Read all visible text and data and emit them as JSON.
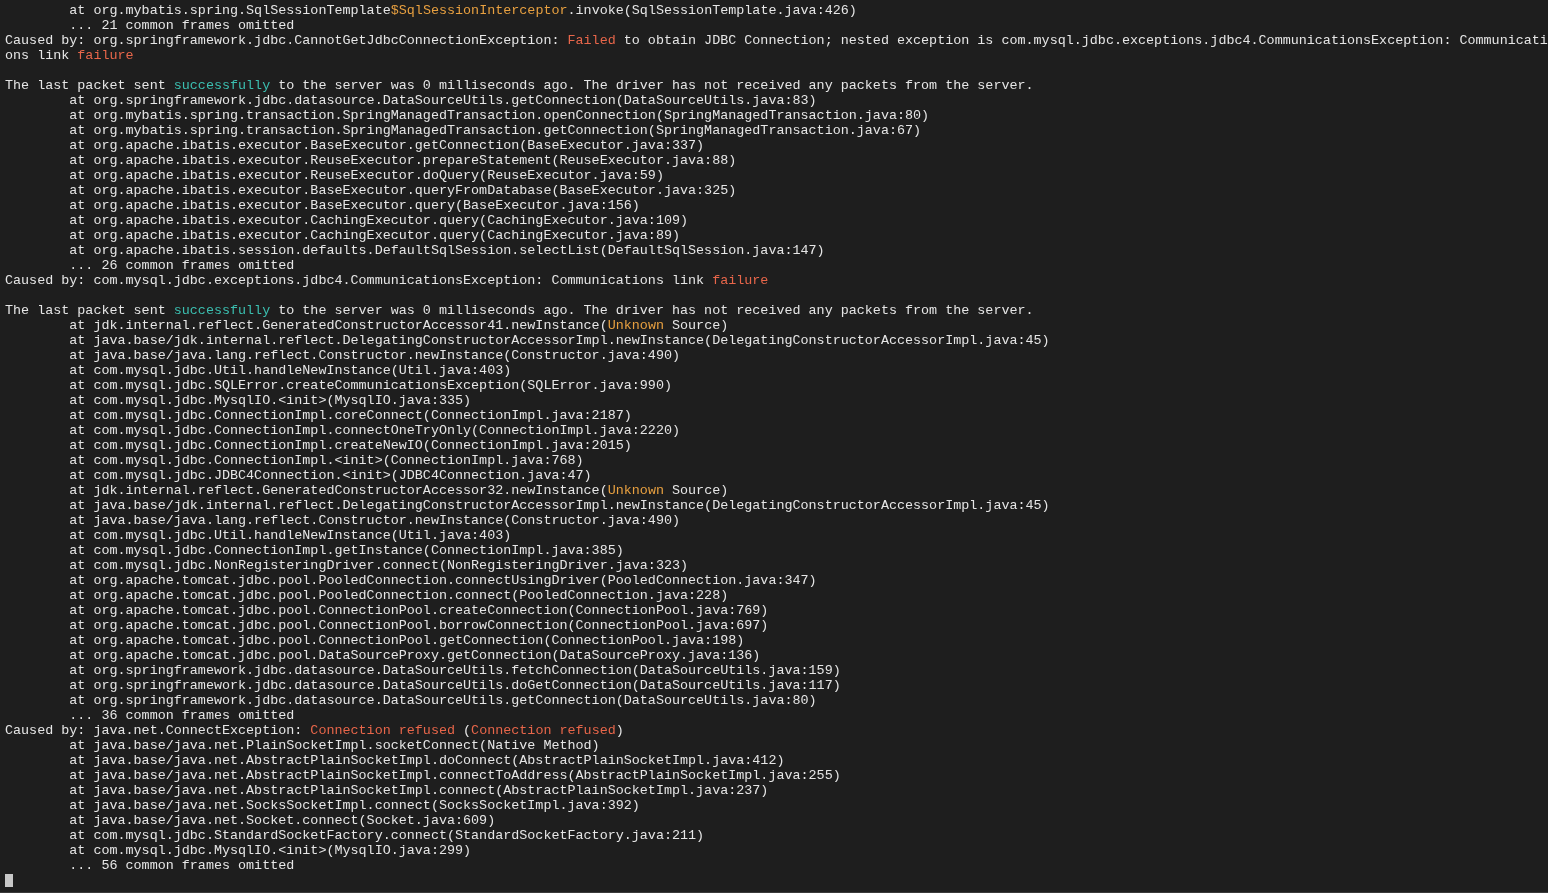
{
  "terminal": {
    "lines": [
      {
        "kind": "text",
        "parts": [
          {
            "text": "\tat org.mybatis.spring.SqlSessionTemplate"
          },
          {
            "text": "$SqlSessionInterceptor",
            "color": "#e8a040"
          },
          {
            "text": ".invoke(SqlSessionTemplate.java:426)"
          }
        ]
      },
      {
        "kind": "text",
        "parts": [
          {
            "text": "\t... 21 common frames omitted"
          }
        ]
      },
      {
        "kind": "text",
        "parts": [
          {
            "text": "Caused by: org.springframework.jdbc.CannotGetJdbcConnectionException: "
          },
          {
            "text": "Failed",
            "color": "#e8664a"
          },
          {
            "text": " to obtain JDBC Connection; nested exception is com.mysql.jdbc.exceptions.jdbc4.CommunicationsException: Communicati"
          }
        ]
      },
      {
        "kind": "text",
        "parts": [
          {
            "text": "ons link "
          },
          {
            "text": "failure",
            "color": "#e8664a"
          }
        ]
      },
      {
        "kind": "blank"
      },
      {
        "kind": "text",
        "parts": [
          {
            "text": "The last packet sent "
          },
          {
            "text": "successfully",
            "color": "#3bbfb0"
          },
          {
            "text": " to the server was 0 milliseconds ago. The driver has not received any packets from the server."
          }
        ]
      },
      {
        "kind": "text",
        "parts": [
          {
            "text": "\tat org.springframework.jdbc.datasource.DataSourceUtils.getConnection(DataSourceUtils.java:83)"
          }
        ]
      },
      {
        "kind": "text",
        "parts": [
          {
            "text": "\tat org.mybatis.spring.transaction.SpringManagedTransaction.openConnection(SpringManagedTransaction.java:80)"
          }
        ]
      },
      {
        "kind": "text",
        "parts": [
          {
            "text": "\tat org.mybatis.spring.transaction.SpringManagedTransaction.getConnection(SpringManagedTransaction.java:67)"
          }
        ]
      },
      {
        "kind": "text",
        "parts": [
          {
            "text": "\tat org.apache.ibatis.executor.BaseExecutor.getConnection(BaseExecutor.java:337)"
          }
        ]
      },
      {
        "kind": "text",
        "parts": [
          {
            "text": "\tat org.apache.ibatis.executor.ReuseExecutor.prepareStatement(ReuseExecutor.java:88)"
          }
        ]
      },
      {
        "kind": "text",
        "parts": [
          {
            "text": "\tat org.apache.ibatis.executor.ReuseExecutor.doQuery(ReuseExecutor.java:59)"
          }
        ]
      },
      {
        "kind": "text",
        "parts": [
          {
            "text": "\tat org.apache.ibatis.executor.BaseExecutor.queryFromDatabase(BaseExecutor.java:325)"
          }
        ]
      },
      {
        "kind": "text",
        "parts": [
          {
            "text": "\tat org.apache.ibatis.executor.BaseExecutor.query(BaseExecutor.java:156)"
          }
        ]
      },
      {
        "kind": "text",
        "parts": [
          {
            "text": "\tat org.apache.ibatis.executor.CachingExecutor.query(CachingExecutor.java:109)"
          }
        ]
      },
      {
        "kind": "text",
        "parts": [
          {
            "text": "\tat org.apache.ibatis.executor.CachingExecutor.query(CachingExecutor.java:89)"
          }
        ]
      },
      {
        "kind": "text",
        "parts": [
          {
            "text": "\tat org.apache.ibatis.session.defaults.DefaultSqlSession.selectList(DefaultSqlSession.java:147)"
          }
        ]
      },
      {
        "kind": "text",
        "parts": [
          {
            "text": "\t... 26 common frames omitted"
          }
        ]
      },
      {
        "kind": "text",
        "parts": [
          {
            "text": "Caused by: com.mysql.jdbc.exceptions.jdbc4.CommunicationsException: Communications link "
          },
          {
            "text": "failure",
            "color": "#e8664a"
          }
        ]
      },
      {
        "kind": "blank"
      },
      {
        "kind": "text",
        "parts": [
          {
            "text": "The last packet sent "
          },
          {
            "text": "successfully",
            "color": "#3bbfb0"
          },
          {
            "text": " to the server was 0 milliseconds ago. The driver has not received any packets from the server."
          }
        ]
      },
      {
        "kind": "text",
        "parts": [
          {
            "text": "\tat jdk.internal.reflect.GeneratedConstructorAccessor41.newInstance("
          },
          {
            "text": "Unknown",
            "color": "#e8a040"
          },
          {
            "text": " Source)"
          }
        ]
      },
      {
        "kind": "text",
        "parts": [
          {
            "text": "\tat java.base/jdk.internal.reflect.DelegatingConstructorAccessorImpl.newInstance(DelegatingConstructorAccessorImpl.java:45)"
          }
        ]
      },
      {
        "kind": "text",
        "parts": [
          {
            "text": "\tat java.base/java.lang.reflect.Constructor.newInstance(Constructor.java:490)"
          }
        ]
      },
      {
        "kind": "text",
        "parts": [
          {
            "text": "\tat com.mysql.jdbc.Util.handleNewInstance(Util.java:403)"
          }
        ]
      },
      {
        "kind": "text",
        "parts": [
          {
            "text": "\tat com.mysql.jdbc.SQLError.createCommunicationsException(SQLError.java:990)"
          }
        ]
      },
      {
        "kind": "text",
        "parts": [
          {
            "text": "\tat com.mysql.jdbc.MysqlIO.<init>(MysqlIO.java:335)"
          }
        ]
      },
      {
        "kind": "text",
        "parts": [
          {
            "text": "\tat com.mysql.jdbc.ConnectionImpl.coreConnect(ConnectionImpl.java:2187)"
          }
        ]
      },
      {
        "kind": "text",
        "parts": [
          {
            "text": "\tat com.mysql.jdbc.ConnectionImpl.connectOneTryOnly(ConnectionImpl.java:2220)"
          }
        ]
      },
      {
        "kind": "text",
        "parts": [
          {
            "text": "\tat com.mysql.jdbc.ConnectionImpl.createNewIO(ConnectionImpl.java:2015)"
          }
        ]
      },
      {
        "kind": "text",
        "parts": [
          {
            "text": "\tat com.mysql.jdbc.ConnectionImpl.<init>(ConnectionImpl.java:768)"
          }
        ]
      },
      {
        "kind": "text",
        "parts": [
          {
            "text": "\tat com.mysql.jdbc.JDBC4Connection.<init>(JDBC4Connection.java:47)"
          }
        ]
      },
      {
        "kind": "text",
        "parts": [
          {
            "text": "\tat jdk.internal.reflect.GeneratedConstructorAccessor32.newInstance("
          },
          {
            "text": "Unknown",
            "color": "#e8a040"
          },
          {
            "text": " Source)"
          }
        ]
      },
      {
        "kind": "text",
        "parts": [
          {
            "text": "\tat java.base/jdk.internal.reflect.DelegatingConstructorAccessorImpl.newInstance(DelegatingConstructorAccessorImpl.java:45)"
          }
        ]
      },
      {
        "kind": "text",
        "parts": [
          {
            "text": "\tat java.base/java.lang.reflect.Constructor.newInstance(Constructor.java:490)"
          }
        ]
      },
      {
        "kind": "text",
        "parts": [
          {
            "text": "\tat com.mysql.jdbc.Util.handleNewInstance(Util.java:403)"
          }
        ]
      },
      {
        "kind": "text",
        "parts": [
          {
            "text": "\tat com.mysql.jdbc.ConnectionImpl.getInstance(ConnectionImpl.java:385)"
          }
        ]
      },
      {
        "kind": "text",
        "parts": [
          {
            "text": "\tat com.mysql.jdbc.NonRegisteringDriver.connect(NonRegisteringDriver.java:323)"
          }
        ]
      },
      {
        "kind": "text",
        "parts": [
          {
            "text": "\tat org.apache.tomcat.jdbc.pool.PooledConnection.connectUsingDriver(PooledConnection.java:347)"
          }
        ]
      },
      {
        "kind": "text",
        "parts": [
          {
            "text": "\tat org.apache.tomcat.jdbc.pool.PooledConnection.connect(PooledConnection.java:228)"
          }
        ]
      },
      {
        "kind": "text",
        "parts": [
          {
            "text": "\tat org.apache.tomcat.jdbc.pool.ConnectionPool.createConnection(ConnectionPool.java:769)"
          }
        ]
      },
      {
        "kind": "text",
        "parts": [
          {
            "text": "\tat org.apache.tomcat.jdbc.pool.ConnectionPool.borrowConnection(ConnectionPool.java:697)"
          }
        ]
      },
      {
        "kind": "text",
        "parts": [
          {
            "text": "\tat org.apache.tomcat.jdbc.pool.ConnectionPool.getConnection(ConnectionPool.java:198)"
          }
        ]
      },
      {
        "kind": "text",
        "parts": [
          {
            "text": "\tat org.apache.tomcat.jdbc.pool.DataSourceProxy.getConnection(DataSourceProxy.java:136)"
          }
        ]
      },
      {
        "kind": "text",
        "parts": [
          {
            "text": "\tat org.springframework.jdbc.datasource.DataSourceUtils.fetchConnection(DataSourceUtils.java:159)"
          }
        ]
      },
      {
        "kind": "text",
        "parts": [
          {
            "text": "\tat org.springframework.jdbc.datasource.DataSourceUtils.doGetConnection(DataSourceUtils.java:117)"
          }
        ]
      },
      {
        "kind": "text",
        "parts": [
          {
            "text": "\tat org.springframework.jdbc.datasource.DataSourceUtils.getConnection(DataSourceUtils.java:80)"
          }
        ]
      },
      {
        "kind": "text",
        "parts": [
          {
            "text": "\t... 36 common frames omitted"
          }
        ]
      },
      {
        "kind": "text",
        "parts": [
          {
            "text": "Caused by: java.net.ConnectException: "
          },
          {
            "text": "Connection refused",
            "color": "#e8664a"
          },
          {
            "text": " ("
          },
          {
            "text": "Connection refused",
            "color": "#e8664a"
          },
          {
            "text": ")"
          }
        ]
      },
      {
        "kind": "text",
        "parts": [
          {
            "text": "\tat java.base/java.net.PlainSocketImpl.socketConnect(Native Method)"
          }
        ]
      },
      {
        "kind": "text",
        "parts": [
          {
            "text": "\tat java.base/java.net.AbstractPlainSocketImpl.doConnect(AbstractPlainSocketImpl.java:412)"
          }
        ]
      },
      {
        "kind": "text",
        "parts": [
          {
            "text": "\tat java.base/java.net.AbstractPlainSocketImpl.connectToAddress(AbstractPlainSocketImpl.java:255)"
          }
        ]
      },
      {
        "kind": "text",
        "parts": [
          {
            "text": "\tat java.base/java.net.AbstractPlainSocketImpl.connect(AbstractPlainSocketImpl.java:237)"
          }
        ]
      },
      {
        "kind": "text",
        "parts": [
          {
            "text": "\tat java.base/java.net.SocksSocketImpl.connect(SocksSocketImpl.java:392)"
          }
        ]
      },
      {
        "kind": "text",
        "parts": [
          {
            "text": "\tat java.base/java.net.Socket.connect(Socket.java:609)"
          }
        ]
      },
      {
        "kind": "text",
        "parts": [
          {
            "text": "\tat com.mysql.jdbc.StandardSocketFactory.connect(StandardSocketFactory.java:211)"
          }
        ]
      },
      {
        "kind": "text",
        "parts": [
          {
            "text": "\tat com.mysql.jdbc.MysqlIO.<init>(MysqlIO.java:299)"
          }
        ]
      },
      {
        "kind": "text",
        "parts": [
          {
            "text": "\t... 56 common frames omitted"
          }
        ]
      }
    ]
  }
}
